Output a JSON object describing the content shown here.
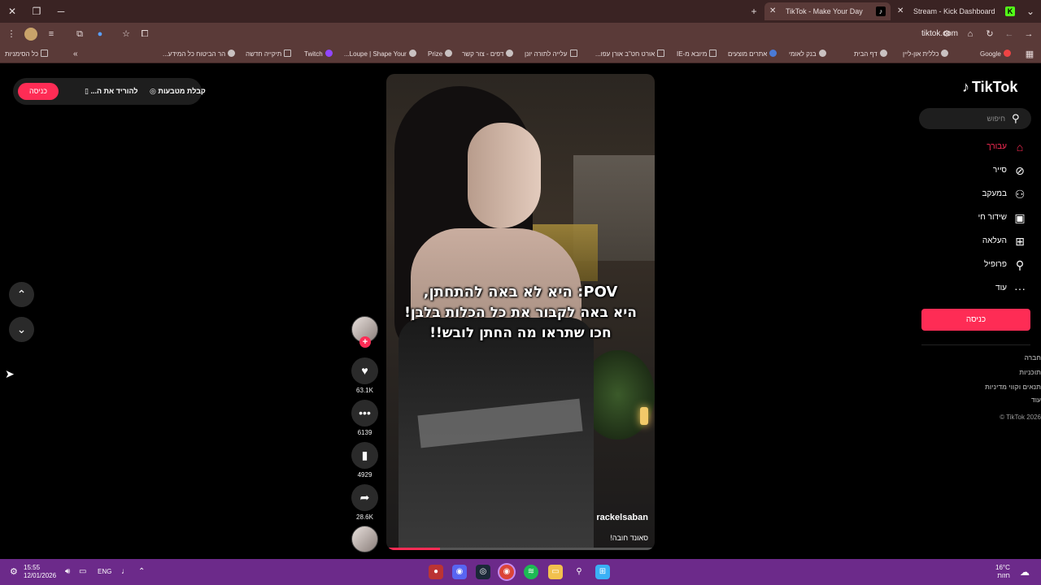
{
  "browser": {
    "tabs": [
      {
        "title": "TikTok - Make Your Day",
        "active": true,
        "favicon": "tiktok-icon"
      },
      {
        "title": "Stream - Kick Dashboard",
        "active": false,
        "favicon": "kick-icon"
      }
    ],
    "url": "tiktok.com",
    "bookmarks": [
      {
        "label": "Google",
        "icon": "google-icon"
      },
      {
        "label": "כללית און-ליין",
        "icon": "site-icon"
      },
      {
        "label": "דף הבית",
        "icon": "site-icon"
      },
      {
        "label": "בנק לאומי",
        "icon": "site-icon"
      },
      {
        "label": "אתרים מוצעים",
        "icon": "folder-icon"
      },
      {
        "label": "מיובא מ-IE",
        "icon": "search-icon"
      },
      {
        "label": "אורט חט\"ב אורן עפו...",
        "icon": "folder-icon"
      },
      {
        "label": "עלייה לתורה יונן",
        "icon": "folder-icon"
      },
      {
        "label": "דפים - צור קשר",
        "icon": "site-icon"
      },
      {
        "label": "Prize",
        "icon": "site-icon"
      },
      {
        "label": "Loupe | Shape Your...",
        "icon": "site-icon"
      },
      {
        "label": "Twitch",
        "icon": "twitch-icon"
      },
      {
        "label": "תיקייה חדשה",
        "icon": "folder-icon"
      },
      {
        "label": "הר הביטוח כל המידע...",
        "icon": "site-icon"
      }
    ],
    "all_bookmarks_label": "כל הסימניות",
    "more_bookmarks": "»"
  },
  "top_pill": {
    "coins_label": "קבלת מטבעות",
    "download_label": "להוריד את ה...",
    "login_label": "כניסה"
  },
  "video": {
    "caption_lines": [
      "POV: היא לא באה להתחתן,",
      "היא באה לקבור את כל הכלות בלבן!",
      "חכו שתראו מה החתן לובש!!"
    ],
    "author": "rackelsaban",
    "sound": "סאונד חובה!",
    "progress": 0.2
  },
  "actions": {
    "likes": "63.1K",
    "comments": "6139",
    "saves": "4929",
    "shares": "28.6K"
  },
  "sidebar": {
    "logo": "TikTok",
    "search_placeholder": "חיפוש",
    "nav": [
      {
        "label": "עבורך",
        "icon": "home-icon",
        "active": true
      },
      {
        "label": "סייר",
        "icon": "compass-icon",
        "active": false
      },
      {
        "label": "במעקב",
        "icon": "following-icon",
        "active": false
      },
      {
        "label": "שידור חי",
        "icon": "live-icon",
        "active": false
      },
      {
        "label": "העלאה",
        "icon": "upload-icon",
        "active": false
      },
      {
        "label": "פרופיל",
        "icon": "profile-icon",
        "active": false
      },
      {
        "label": "עוד",
        "icon": "more-icon",
        "active": false
      }
    ],
    "login_button": "כניסה",
    "footer": [
      "חברה",
      "תוכניות",
      "תנאים וקווי מדיניות",
      "עוד",
      "© TikTok 2026"
    ]
  },
  "taskbar": {
    "time": "15:55",
    "date": "12/01/2026",
    "language": "ENG",
    "weather_temp": "16°C",
    "weather_desc": "חזות",
    "apps": [
      "chrome-icon",
      "spotify-icon",
      "files-icon",
      "search-icon",
      "windows-start-icon"
    ]
  },
  "colors": {
    "accent": "#fe2c55",
    "tabbar": "#3a2323",
    "toolbar": "#5a3a38",
    "taskbar": "#6c2a8a"
  }
}
